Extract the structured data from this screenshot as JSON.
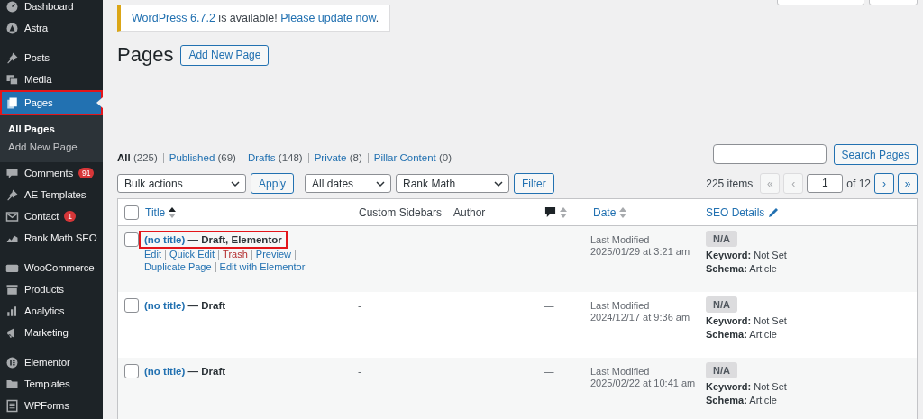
{
  "sidebar": {
    "groups": [
      [
        {
          "label": "Dashboard",
          "selected": false,
          "highlighted": false
        },
        {
          "label": "Astra",
          "selected": false,
          "highlighted": false
        }
      ],
      [
        {
          "label": "Posts",
          "selected": false,
          "highlighted": false
        },
        {
          "label": "Media",
          "selected": false,
          "highlighted": false
        },
        {
          "label": "Pages",
          "selected": true,
          "highlighted": true,
          "children": [
            {
              "label": "All Pages",
              "selected": true
            },
            {
              "label": "Add New Page",
              "selected": false
            }
          ]
        },
        {
          "label": "Comments",
          "selected": false,
          "highlighted": false,
          "badge": "91"
        },
        {
          "label": "AE Templates",
          "selected": false,
          "highlighted": false
        },
        {
          "label": "Contact",
          "selected": false,
          "highlighted": false,
          "badge": "1"
        },
        {
          "label": "Rank Math SEO",
          "selected": false,
          "highlighted": false
        }
      ],
      [
        {
          "label": "WooCommerce",
          "selected": false,
          "highlighted": false
        },
        {
          "label": "Products",
          "selected": false,
          "highlighted": false
        },
        {
          "label": "Analytics",
          "selected": false,
          "highlighted": false
        },
        {
          "label": "Marketing",
          "selected": false,
          "highlighted": false
        }
      ],
      [
        {
          "label": "Elementor",
          "selected": false,
          "highlighted": false
        },
        {
          "label": "Templates",
          "selected": false,
          "highlighted": false
        },
        {
          "label": "WPForms",
          "selected": false,
          "highlighted": false
        }
      ]
    ]
  },
  "notice": {
    "segments": [
      {
        "kind": "link",
        "text": "WordPress 6.7.2"
      },
      {
        "kind": "text",
        "text": " is available! "
      },
      {
        "kind": "link",
        "text": "Please update now"
      },
      {
        "kind": "text",
        "text": "."
      }
    ]
  },
  "heading": {
    "title": "Pages",
    "button": "Add New Page"
  },
  "views": [
    {
      "label": "All",
      "count": "(225)",
      "selected": true
    },
    {
      "label": "Published",
      "count": "(69)",
      "selected": false
    },
    {
      "label": "Drafts",
      "count": "(148)",
      "selected": false
    },
    {
      "label": "Private",
      "count": "(8)",
      "selected": false
    },
    {
      "label": "Pillar Content",
      "count": "(0)",
      "selected": false
    }
  ],
  "search": {
    "button": "Search Pages"
  },
  "toolbar": {
    "bulk_actions": "Bulk actions",
    "apply": "Apply",
    "dates": "All dates",
    "rank_math": "Rank Math",
    "filter": "Filter"
  },
  "pagination": {
    "items": "225 items",
    "first": {
      "label": "«",
      "disabled": true
    },
    "prev": {
      "label": "‹",
      "disabled": true
    },
    "page": "1",
    "of": "of 12",
    "next": {
      "label": "›",
      "disabled": false
    },
    "last": {
      "label": "»",
      "disabled": false
    }
  },
  "table": {
    "select_all": {
      "checked": false
    },
    "columns": [
      {
        "kind": "sortable",
        "label": "Title",
        "sorted": true
      },
      {
        "kind": "plain",
        "label": "Custom Sidebars"
      },
      {
        "kind": "plain",
        "label": "Author"
      },
      {
        "kind": "comments"
      },
      {
        "kind": "sortable",
        "label": "Date",
        "sorted": false
      },
      {
        "kind": "edit",
        "label": "SEO Details"
      }
    ],
    "rows": [
      {
        "checked": false,
        "title": "(no title)",
        "state": " — Draft, Elementor",
        "highlighted": true,
        "actions": [
          {
            "kind": "link",
            "label": "Edit"
          },
          {
            "kind": "link",
            "label": "Quick Edit"
          },
          {
            "kind": "danger",
            "label": "Trash"
          },
          {
            "kind": "link",
            "label": "Preview"
          },
          {
            "kind": "link",
            "label": "Duplicate Page"
          },
          {
            "kind": "link",
            "label": "Edit with Elementor"
          }
        ],
        "sidebars": "-",
        "comments": "—",
        "date_label": "Last Modified",
        "date": "2025/01/29 at 3:21 am",
        "seo_score": "N/A",
        "keyword_label": "Keyword:",
        "keyword": "Not Set",
        "schema_label": "Schema:",
        "schema": "Article"
      },
      {
        "checked": false,
        "title": "(no title)",
        "state": " — Draft",
        "highlighted": false,
        "sidebars": "-",
        "comments": "—",
        "date_label": "Last Modified",
        "date": "2024/12/17 at 9:36 am",
        "seo_score": "N/A",
        "keyword_label": "Keyword:",
        "keyword": "Not Set",
        "schema_label": "Schema:",
        "schema": "Article"
      },
      {
        "checked": false,
        "title": "(no title)",
        "state": " — Draft",
        "highlighted": false,
        "sidebars": "-",
        "comments": "—",
        "date_label": "Last Modified",
        "date": "2025/02/22 at 10:41 am",
        "seo_score": "N/A",
        "keyword_label": "Keyword:",
        "keyword": "Not Set",
        "schema_label": "Schema:",
        "schema": "Article"
      }
    ]
  }
}
